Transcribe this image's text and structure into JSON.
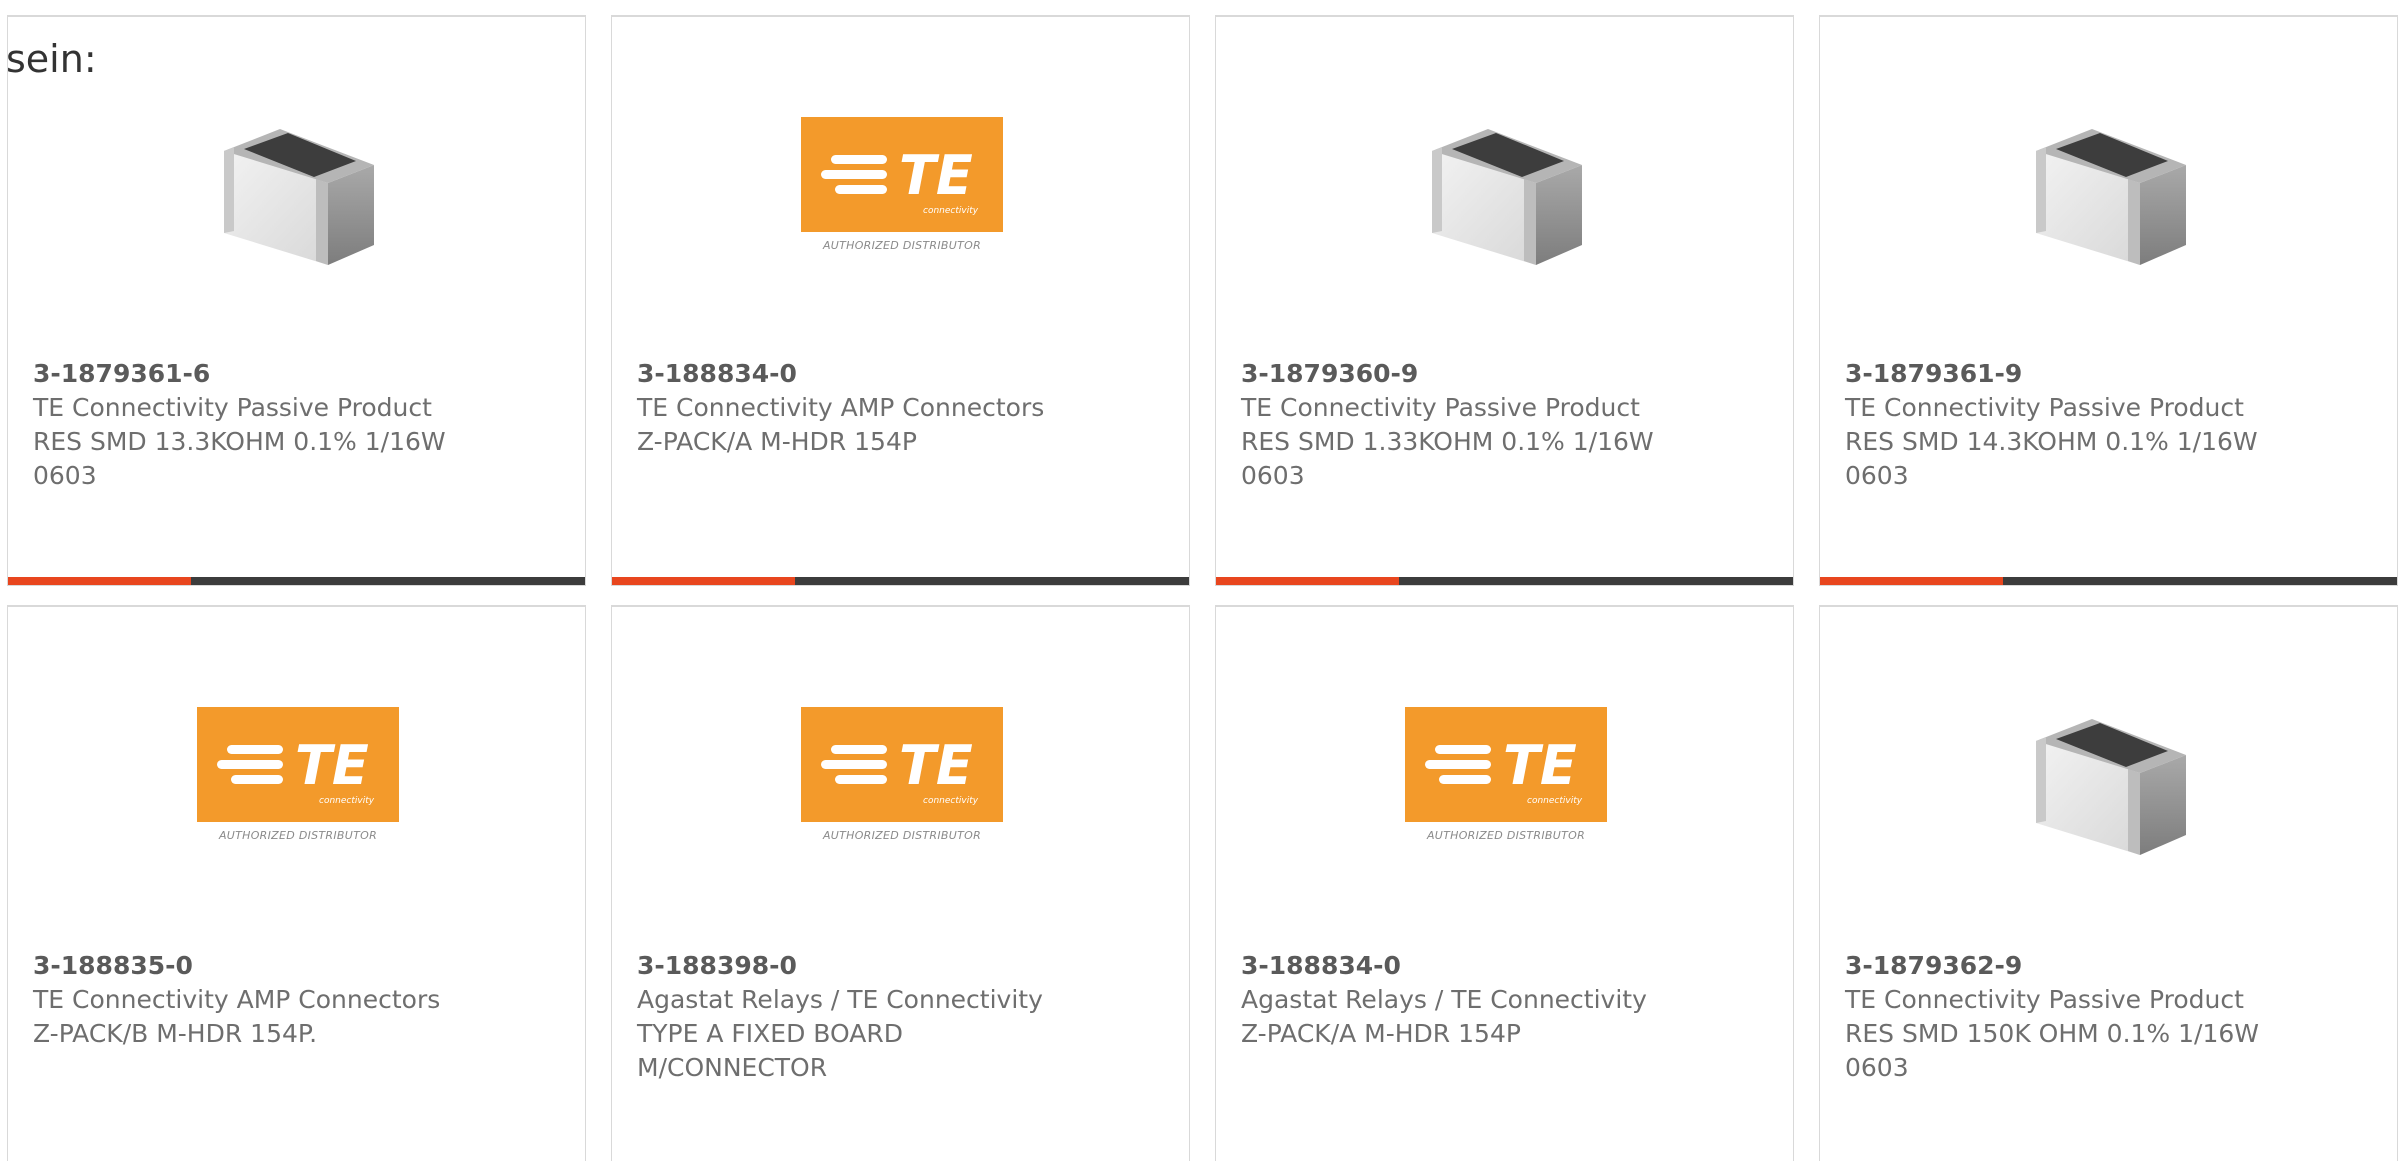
{
  "intro": {
    "text": "sein:"
  },
  "brand": {
    "logo_text": "TE",
    "logo_subtext": "connectivity",
    "authorized_text": "AUTHORIZED DISTRIBUTOR",
    "orange": "#f39a2b",
    "accent": "#e8461e",
    "bar_dark": "#3c3c3c"
  },
  "products": [
    {
      "part": "3-1879361-6",
      "manufacturer": "TE Connectivity Passive Product",
      "desc_lines": [
        "RES SMD 13.3KOHM 0.1% 1/16W",
        "0603"
      ],
      "image": "chip-resistor"
    },
    {
      "part": "3-188834-0",
      "manufacturer": "TE Connectivity AMP Connectors",
      "desc_lines": [
        "Z-PACK/A M-HDR 154P"
      ],
      "image": "te-logo"
    },
    {
      "part": "3-1879360-9",
      "manufacturer": "TE Connectivity Passive Product",
      "desc_lines": [
        "RES SMD 1.33KOHM 0.1% 1/16W",
        "0603"
      ],
      "image": "chip-resistor"
    },
    {
      "part": "3-1879361-9",
      "manufacturer": "TE Connectivity Passive Product",
      "desc_lines": [
        "RES SMD 14.3KOHM 0.1% 1/16W",
        "0603"
      ],
      "image": "chip-resistor"
    },
    {
      "part": "3-188835-0",
      "manufacturer": "TE Connectivity AMP Connectors",
      "desc_lines": [
        "Z-PACK/B M-HDR 154P."
      ],
      "image": "te-logo"
    },
    {
      "part": "3-188398-0",
      "manufacturer": "Agastat Relays / TE Connectivity",
      "desc_lines": [
        "TYPE A FIXED BOARD",
        "M/CONNECTOR"
      ],
      "image": "te-logo"
    },
    {
      "part": "3-188834-0",
      "manufacturer": "Agastat Relays / TE Connectivity",
      "desc_lines": [
        "Z-PACK/A M-HDR 154P"
      ],
      "image": "te-logo"
    },
    {
      "part": "3-1879362-9",
      "manufacturer": "TE Connectivity Passive Product",
      "desc_lines": [
        "RES SMD 150K OHM 0.1% 1/16W",
        "0603"
      ],
      "image": "chip-resistor"
    }
  ]
}
